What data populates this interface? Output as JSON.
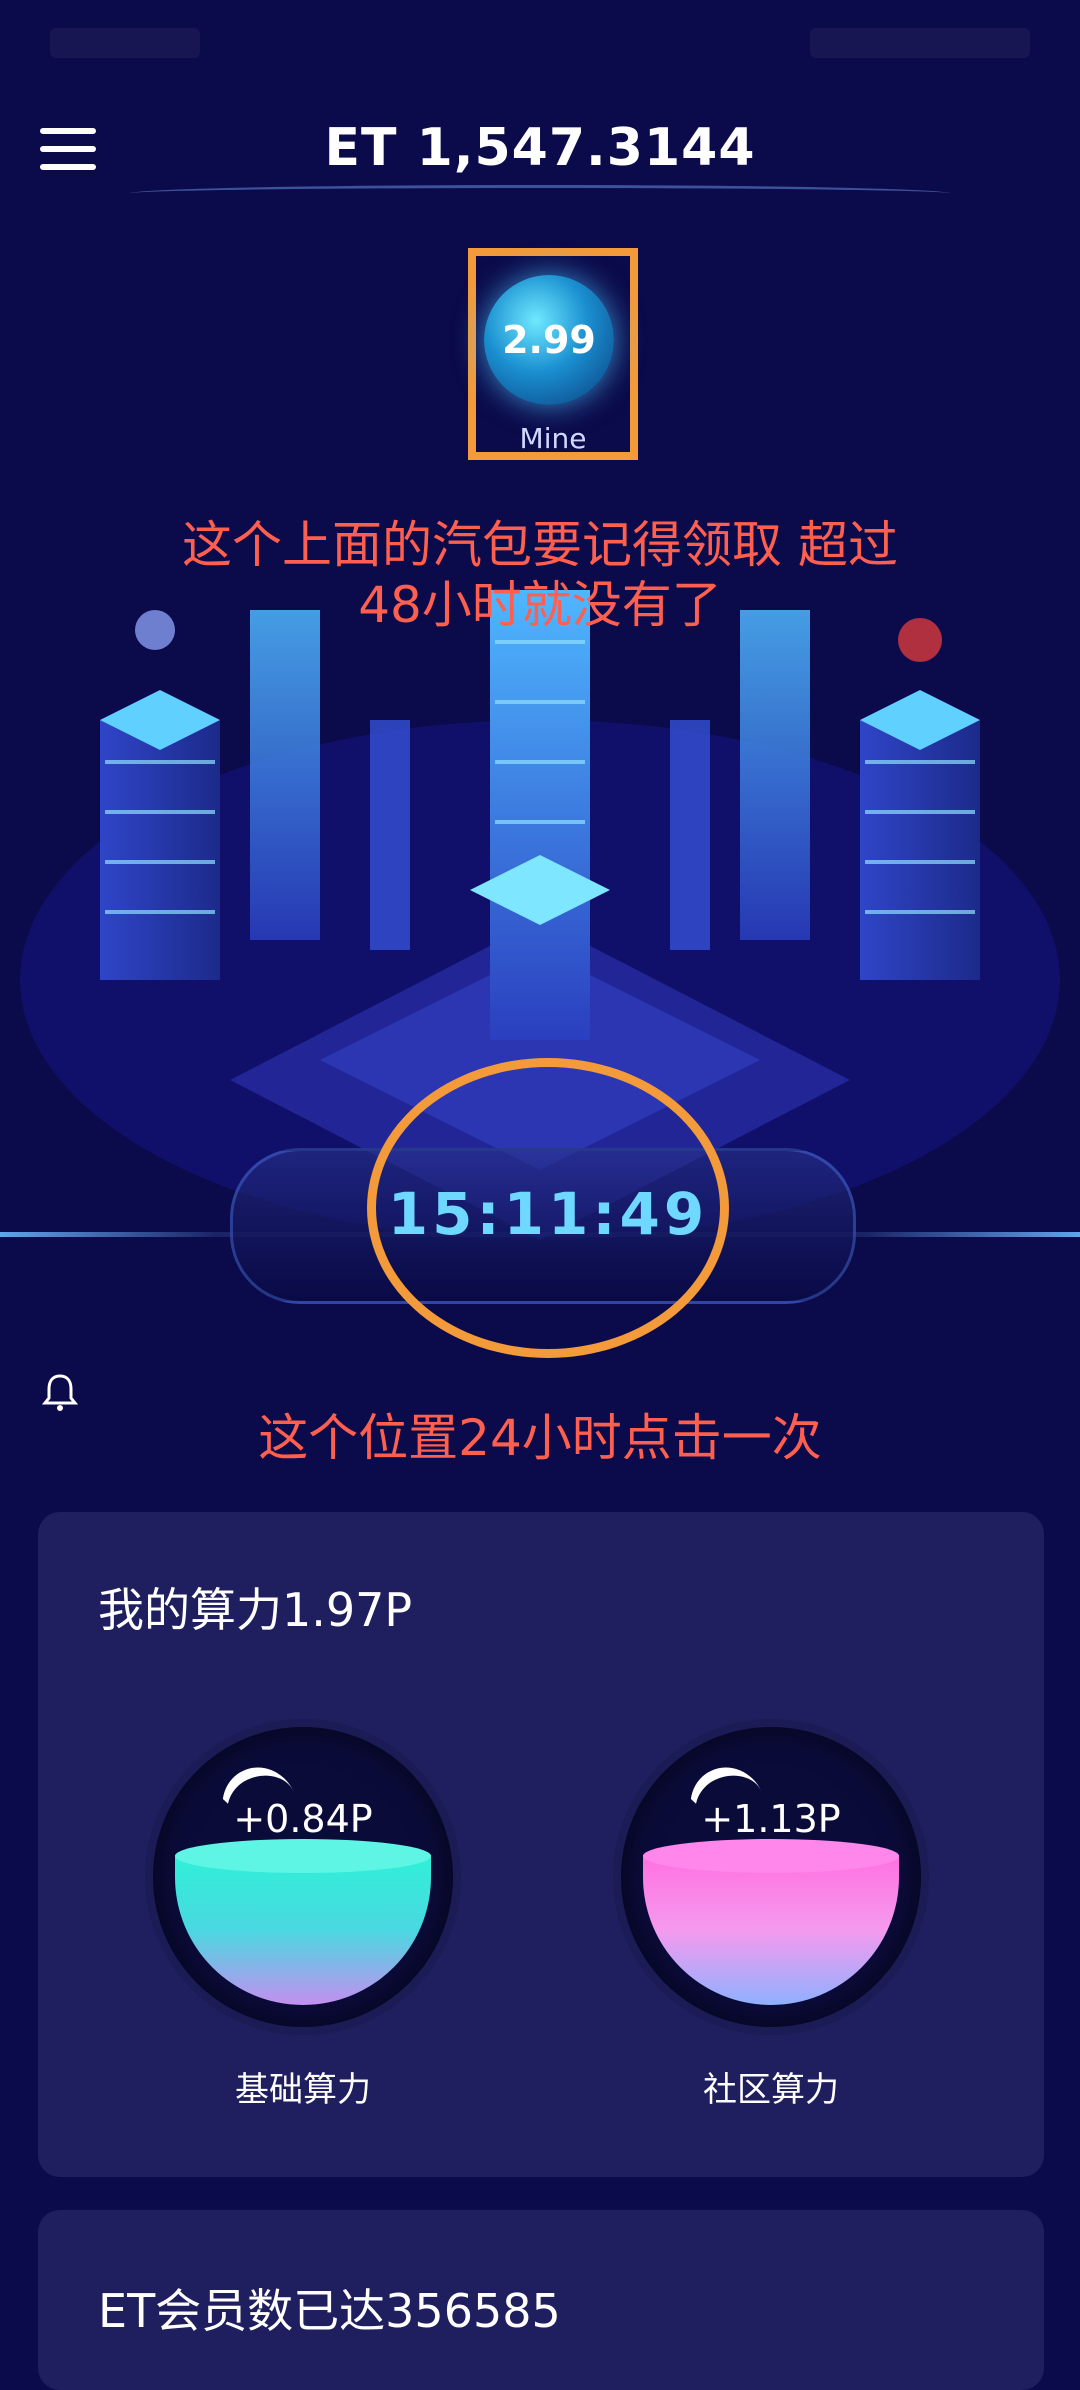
{
  "header": {
    "balance": "ET 1,547.3144"
  },
  "mine": {
    "value": "2.99",
    "label": "Mine"
  },
  "annotations": {
    "note_top_line1": "这个上面的汽包要记得领取 超过",
    "note_top_line2": "48小时就没有了",
    "note_timer": "这个位置24小时点击一次"
  },
  "timer": {
    "value": "15:11:49"
  },
  "hashpower": {
    "title": "我的算力1.97P",
    "base": {
      "value": "+0.84P",
      "label": "基础算力"
    },
    "community": {
      "value": "+1.13P",
      "label": "社区算力"
    }
  },
  "members": {
    "title": "ET会员数已达356585"
  },
  "colors": {
    "background": "#0b0a4a",
    "card": "#1f1e5e",
    "annotation": "#ff5f4f",
    "highlight": "#f39a3a",
    "timer": "#6fd8ff"
  },
  "icons": {
    "menu": "menu-icon",
    "bell": "bell-icon"
  }
}
